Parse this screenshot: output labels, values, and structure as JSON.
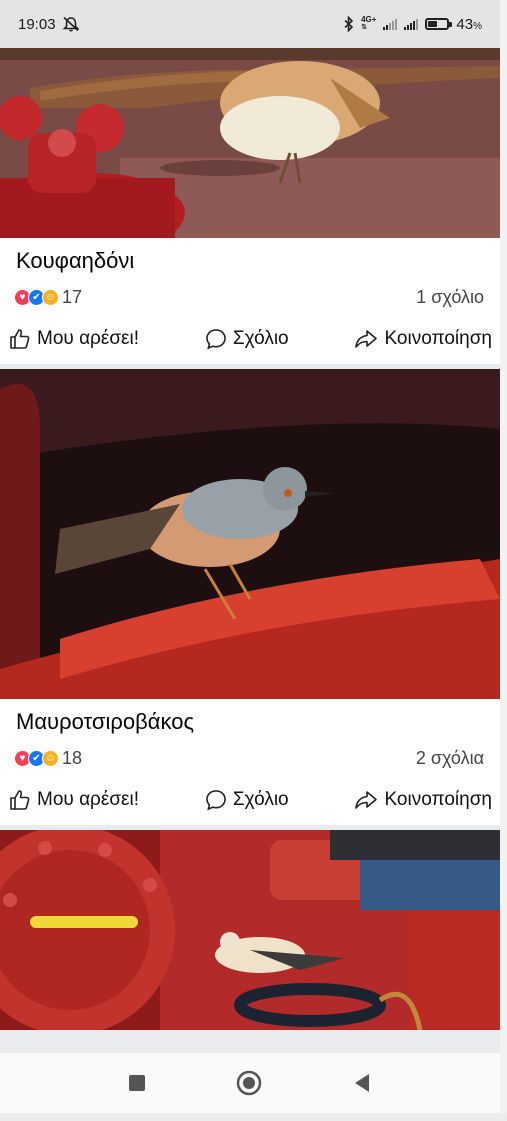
{
  "status_bar": {
    "time": "19:03",
    "network": "4G+",
    "battery_percent": "43",
    "battery_suffix": "%"
  },
  "posts": [
    {
      "title": "Κουφαηδόνι",
      "reaction_count": "17",
      "comments": "1 σχόλιο",
      "actions": {
        "like": "Μου αρέσει!",
        "comment": "Σχόλιο",
        "share": "Κοινοποίηση"
      }
    },
    {
      "title": "Μαυροτσιροβάκος",
      "reaction_count": "18",
      "comments": "2 σχόλια",
      "actions": {
        "like": "Μου αρέσει!",
        "comment": "Σχόλιο",
        "share": "Κοινοποίηση"
      }
    }
  ],
  "reaction_icons": [
    "love-icon",
    "like-icon",
    "care-icon"
  ],
  "nav": [
    "recents-square-icon",
    "home-circle-icon",
    "back-triangle-icon"
  ],
  "colors": {
    "love": "#f33e58",
    "like": "#1877f2",
    "care": "#f7b125"
  }
}
